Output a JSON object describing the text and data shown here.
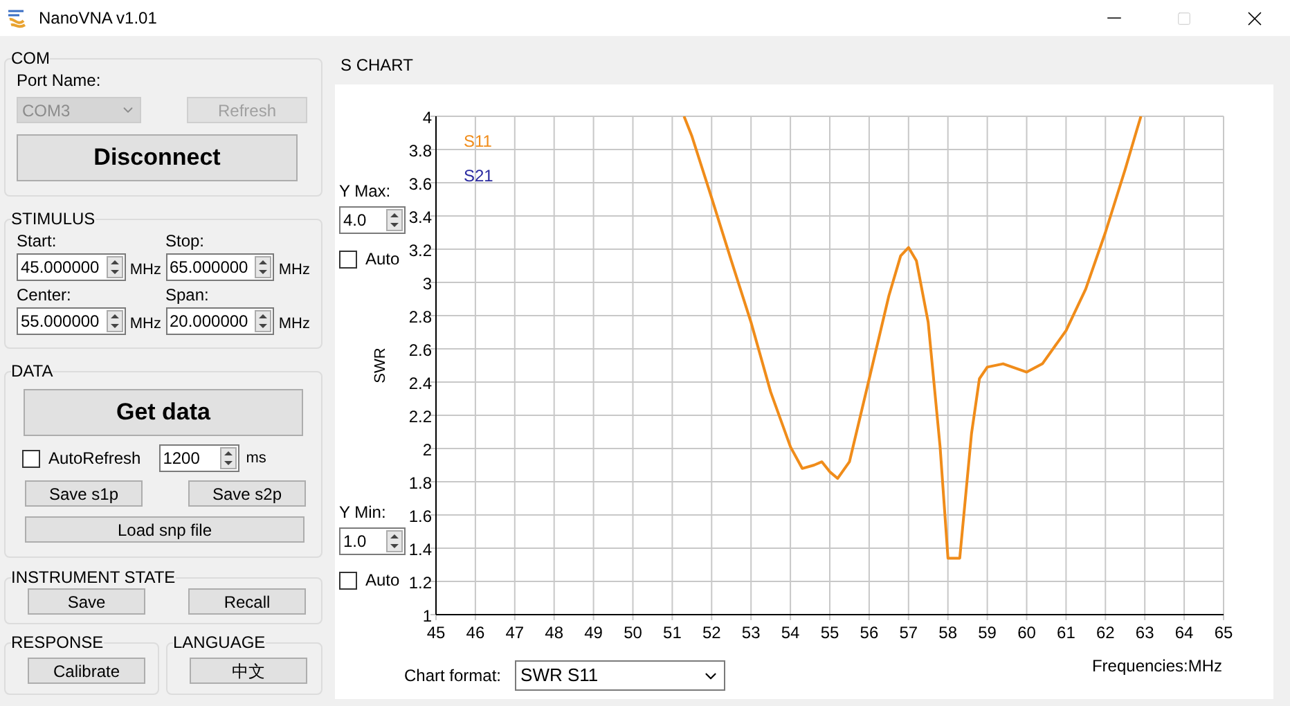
{
  "window": {
    "title": "NanoVNA v1.01"
  },
  "com": {
    "title": "COM",
    "port_label": "Port Name:",
    "port": {
      "value": "COM3",
      "disabled": true
    },
    "refresh": {
      "label": "Refresh",
      "disabled": true
    },
    "connect_button": "Disconnect"
  },
  "stimulus": {
    "title": "STIMULUS",
    "fields": [
      {
        "label": "Start:",
        "value": "45.000000",
        "unit": "MHz"
      },
      {
        "label": "Stop:",
        "value": "65.000000",
        "unit": "MHz"
      },
      {
        "label": "Center:",
        "value": "55.000000",
        "unit": "MHz"
      },
      {
        "label": "Span:",
        "value": "20.000000",
        "unit": "MHz"
      }
    ]
  },
  "data": {
    "title": "DATA",
    "get_button": "Get data",
    "auto_refresh": {
      "label": "AutoRefresh",
      "checked": false
    },
    "interval": {
      "value": "1200",
      "unit": "ms"
    },
    "buttons": [
      "Save s1p",
      "Save s2p"
    ],
    "load_button": "Load snp file"
  },
  "instrument_state": {
    "title": "INSTRUMENT STATE",
    "buttons": [
      "Save",
      "Recall"
    ]
  },
  "response": {
    "title": "RESPONSE",
    "button": "Calibrate"
  },
  "language": {
    "title": "LANGUAGE",
    "button": "中文"
  },
  "s_chart": {
    "title": "S CHART",
    "y_max": {
      "label": "Y Max:",
      "value": "4.0",
      "auto_label": "Auto",
      "auto": false
    },
    "y_min": {
      "label": "Y Min:",
      "value": "1.0",
      "auto_label": "Auto",
      "auto": false
    },
    "chart_format": {
      "label": "Chart format:",
      "value": "SWR S11"
    },
    "chart_data": {
      "type": "line",
      "grid": true,
      "xlabel": "Frequencies:MHz",
      "ylabel": "SWR",
      "xlim": [
        45,
        65
      ],
      "ylim": [
        1,
        4
      ],
      "xticks": [
        45,
        46,
        47,
        48,
        49,
        50,
        51,
        52,
        53,
        54,
        55,
        56,
        57,
        58,
        59,
        60,
        61,
        62,
        63,
        64,
        65
      ],
      "yticks": [
        1,
        1.2,
        1.4,
        1.6,
        1.8,
        2,
        2.2,
        2.4,
        2.6,
        2.8,
        3,
        3.2,
        3.4,
        3.6,
        3.8,
        4
      ],
      "x": [
        51.3,
        51.5,
        52,
        52.5,
        53,
        53.5,
        54,
        54.3,
        54.6,
        54.8,
        55,
        55.2,
        55.5,
        56,
        56.5,
        56.8,
        57,
        57.2,
        57.5,
        57.8,
        58,
        58.3,
        58.6,
        58.8,
        59,
        59.4,
        60,
        60.4,
        61,
        61.5,
        62,
        62.5,
        62.8,
        62.9
      ],
      "series": [
        {
          "name": "S11",
          "color": "#f08c1a",
          "values": [
            4.0,
            3.88,
            3.51,
            3.13,
            2.76,
            2.34,
            2.01,
            1.88,
            1.9,
            1.92,
            1.86,
            1.82,
            1.92,
            2.42,
            2.92,
            3.16,
            3.21,
            3.13,
            2.76,
            2.01,
            1.34,
            1.34,
            2.09,
            2.42,
            2.49,
            2.51,
            2.46,
            2.51,
            2.71,
            2.96,
            3.3,
            3.68,
            3.92,
            4.0
          ]
        },
        {
          "name": "S21",
          "color": "#2a2aa0",
          "values": [
            null,
            null,
            null,
            null,
            null,
            null,
            null,
            null,
            null,
            null,
            null,
            null,
            null,
            null,
            null,
            null,
            null,
            null,
            null,
            null,
            null,
            null,
            null,
            null,
            null,
            null,
            null,
            null,
            null,
            null,
            null,
            null,
            null,
            null
          ]
        }
      ]
    }
  }
}
